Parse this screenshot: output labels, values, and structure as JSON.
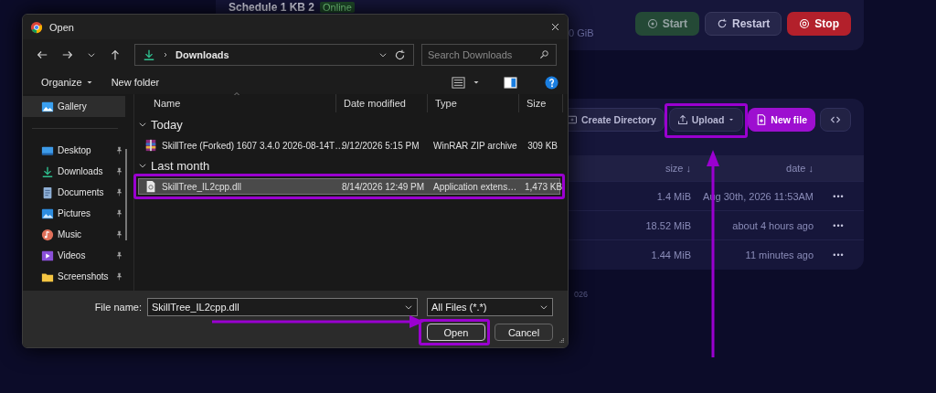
{
  "server": {
    "name": "Schedule 1 KB 2",
    "status": "Online",
    "usage_fragment": "0 GiB",
    "actions": [
      {
        "label": "Start",
        "kind": "start",
        "disabled": true
      },
      {
        "label": "Restart",
        "kind": "restart",
        "disabled": false
      },
      {
        "label": "Stop",
        "kind": "stop",
        "disabled": false
      }
    ]
  },
  "files_panel": {
    "actions": [
      {
        "label": "Create Directory",
        "kind": "create",
        "highlighted": false
      },
      {
        "label": "Upload",
        "kind": "upload",
        "highlighted": true
      },
      {
        "label": "New file",
        "kind": "new",
        "highlighted": false
      },
      {
        "kind": "code",
        "highlighted": false
      }
    ],
    "columns": [
      "size ↓",
      "date ↓"
    ],
    "rows": [
      {
        "size": "1.4 MiB",
        "date": "Aug 30th, 2026 11:53AM",
        "menu": "•••"
      },
      {
        "size": "18.52 MiB",
        "date": "about 4 hours ago",
        "menu": "•••"
      },
      {
        "size": "1.44 MiB",
        "date": "11 minutes ago",
        "menu": "•••"
      }
    ],
    "footer_fragment": "026"
  },
  "dialog": {
    "title": "Open",
    "path": "Downloads",
    "search": {
      "placeholder": "Search Downloads"
    },
    "toolbar": {
      "organize": "Organize",
      "new_folder": "New folder"
    },
    "nav": [
      {
        "label": "Gallery",
        "kind": "gallery",
        "pinned": false,
        "selected": true
      },
      {
        "label": "Desktop",
        "kind": "desktop",
        "pinned": true,
        "selected": false
      },
      {
        "label": "Downloads",
        "kind": "downloads",
        "pinned": true,
        "selected": false
      },
      {
        "label": "Documents",
        "kind": "documents",
        "pinned": true,
        "selected": false
      },
      {
        "label": "Pictures",
        "kind": "pictures",
        "pinned": true,
        "selected": false
      },
      {
        "label": "Music",
        "kind": "music",
        "pinned": true,
        "selected": false
      },
      {
        "label": "Videos",
        "kind": "videos",
        "pinned": true,
        "selected": false
      },
      {
        "label": "Screenshots",
        "kind": "folder",
        "pinned": true,
        "selected": false
      }
    ],
    "columns": [
      "Name",
      "Date modified",
      "Type",
      "Size"
    ],
    "groups": [
      {
        "label": "Today",
        "expanded": true,
        "files": [
          {
            "name": "SkillTree (Forked) 1607 3.4.0 2026-08-14T…",
            "date": "9/12/2026 5:15 PM",
            "type": "WinRAR ZIP archive",
            "size": "309 KB",
            "kind": "archive",
            "selected": false,
            "highlighted": false
          }
        ]
      },
      {
        "label": "Last month",
        "expanded": true,
        "files": [
          {
            "name": "SkillTree_IL2cpp.dll",
            "date": "8/14/2026 12:49 PM",
            "type": "Application extens…",
            "size": "1,473 KB",
            "kind": "dll",
            "selected": true,
            "highlighted": true
          }
        ]
      }
    ],
    "file_name": {
      "label": "File name:",
      "value": "SkillTree_IL2cpp.dll"
    },
    "file_type": "All Files (*.*)",
    "buttons": [
      {
        "label": "Open",
        "kind": "primary",
        "highlighted": true
      },
      {
        "label": "Cancel",
        "kind": "secondary",
        "highlighted": false
      }
    ]
  }
}
